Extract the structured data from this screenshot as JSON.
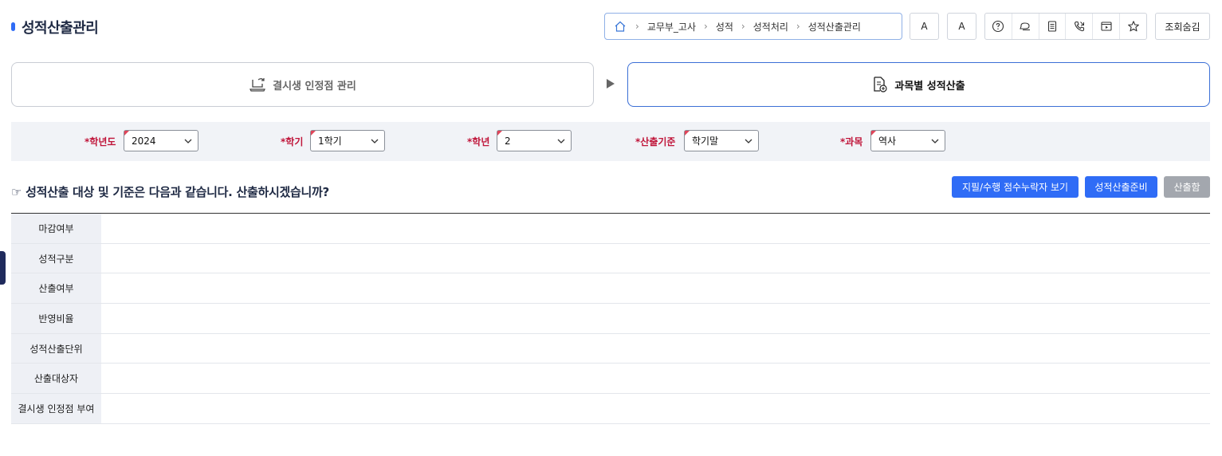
{
  "page": {
    "title": "성적산출관리"
  },
  "breadcrumb": {
    "items": [
      "교무부_고사",
      "성적",
      "성적처리",
      "성적산출관리"
    ]
  },
  "header_buttons": {
    "font_large": "A",
    "font_small": "A",
    "hide": "조회숨김"
  },
  "header_icons": [
    "help-icon",
    "chat-icon",
    "document-icon",
    "phone-icon",
    "video-icon",
    "star-icon"
  ],
  "steps": {
    "step1": "결시생 인정점 관리",
    "step2": "과목별 성적산출"
  },
  "filters": {
    "year": {
      "label": "*학년도",
      "value": "2024"
    },
    "semester": {
      "label": "*학기",
      "value": "1학기"
    },
    "grade": {
      "label": "*학년",
      "value": "2"
    },
    "basis": {
      "label": "*산출기준",
      "value": "학기말"
    },
    "subject": {
      "label": "*과목",
      "value": "역사"
    }
  },
  "section": {
    "title": "☞ 성적산출 대상 및 기준은 다음과 같습니다. 산출하시겠습니까?"
  },
  "actions": {
    "view_missing": "지필/수행 점수누락자 보기",
    "prepare": "성적산출준비",
    "calculate": "산출함"
  },
  "table": {
    "rows": [
      "마감여부",
      "성적구분",
      "산출여부",
      "반영비율",
      "성적산출단위",
      "산출대상자",
      "결시생 인정점 부여"
    ]
  },
  "colors": {
    "accent": "#2f6cf6",
    "required": "#c0153a",
    "disabled": "#a3a7ae"
  }
}
